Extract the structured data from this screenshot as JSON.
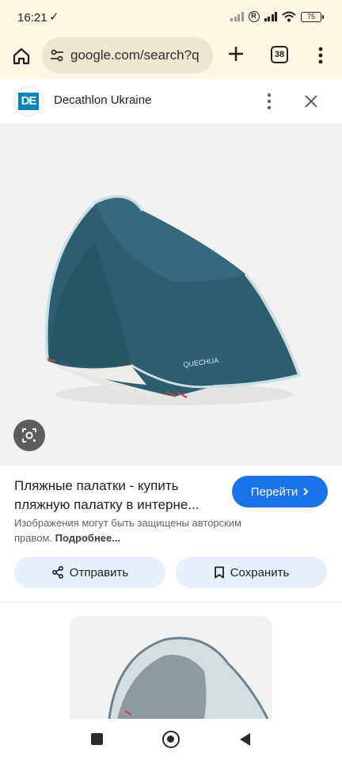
{
  "status_bar": {
    "time": "16:21",
    "check_glyph": "✓",
    "r_badge": "R",
    "battery_level": "75",
    "icons": [
      "signal-faint-icon",
      "r-badge-icon",
      "signal-icon",
      "wifi-icon",
      "battery-icon"
    ]
  },
  "browser": {
    "url": "google.com/search?q",
    "tab_count": "38",
    "icons": [
      "home-icon",
      "site-settings-icon",
      "new-tab-icon",
      "tab-switcher-icon",
      "more-menu-icon"
    ]
  },
  "site": {
    "logo_text": "DE",
    "name": "Decathlon Ukraine",
    "logo_color": "#0082c3",
    "icons": [
      "more-options-icon",
      "close-icon"
    ]
  },
  "result": {
    "title": "Пляжные палатки - купить пляжную палатку в интерне...",
    "go_label": "Перейти",
    "copyright_text": "Изображения могут быть защищены авторским правом.",
    "more_link": "Подробнее...",
    "share_label": "Отправить",
    "save_label": "Сохранить",
    "tent_brand": "QUECHUA"
  },
  "colors": {
    "accent": "#1a73e8",
    "chip_bg": "#e8f0fe",
    "toolbar_bg": "#fdf7e3",
    "tent_blue": "#2c5e6e"
  }
}
